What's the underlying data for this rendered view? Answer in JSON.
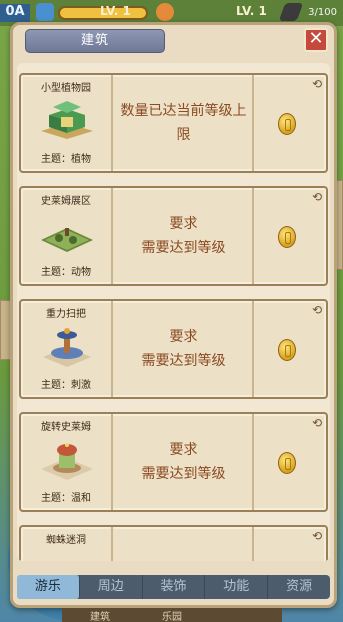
{
  "hud": {
    "level_badge": "0A",
    "level_text_1": "LV. 1",
    "level_text_2": "LV. 1",
    "count": "3/100"
  },
  "panel": {
    "title": "建筑",
    "close_label": "✕"
  },
  "cards": [
    {
      "name": "小型植物园",
      "theme": "主题：植物",
      "message_lines": [
        "数量已达当前等级上限"
      ]
    },
    {
      "name": "史莱姆展区",
      "theme": "主题：动物",
      "message_lines": [
        "要求",
        "需要达到等级"
      ]
    },
    {
      "name": "重力扫把",
      "theme": "主题：刺激",
      "message_lines": [
        "要求",
        "需要达到等级"
      ]
    },
    {
      "name": "旋转史莱姆",
      "theme": "主题：温和",
      "message_lines": [
        "要求",
        "需要达到等级"
      ]
    },
    {
      "name": "蜘蛛迷洞",
      "theme": "",
      "message_lines": []
    }
  ],
  "tabs": [
    {
      "label": "游乐",
      "active": true
    },
    {
      "label": "周边",
      "active": false
    },
    {
      "label": "装饰",
      "active": false
    },
    {
      "label": "功能",
      "active": false
    },
    {
      "label": "资源",
      "active": false
    }
  ],
  "bottom_strip": {
    "left": "建筑",
    "right": "乐园"
  },
  "colors": {
    "panel_bg": "#e9dcc2",
    "card_border": "#9a7f57",
    "message_text": "#8a4a22",
    "tab_active": "#8fb8d9",
    "close_button": "#c64a3c"
  },
  "icons": {
    "coin": "coin-icon",
    "corner": "rotate-icon",
    "close": "close-icon"
  }
}
